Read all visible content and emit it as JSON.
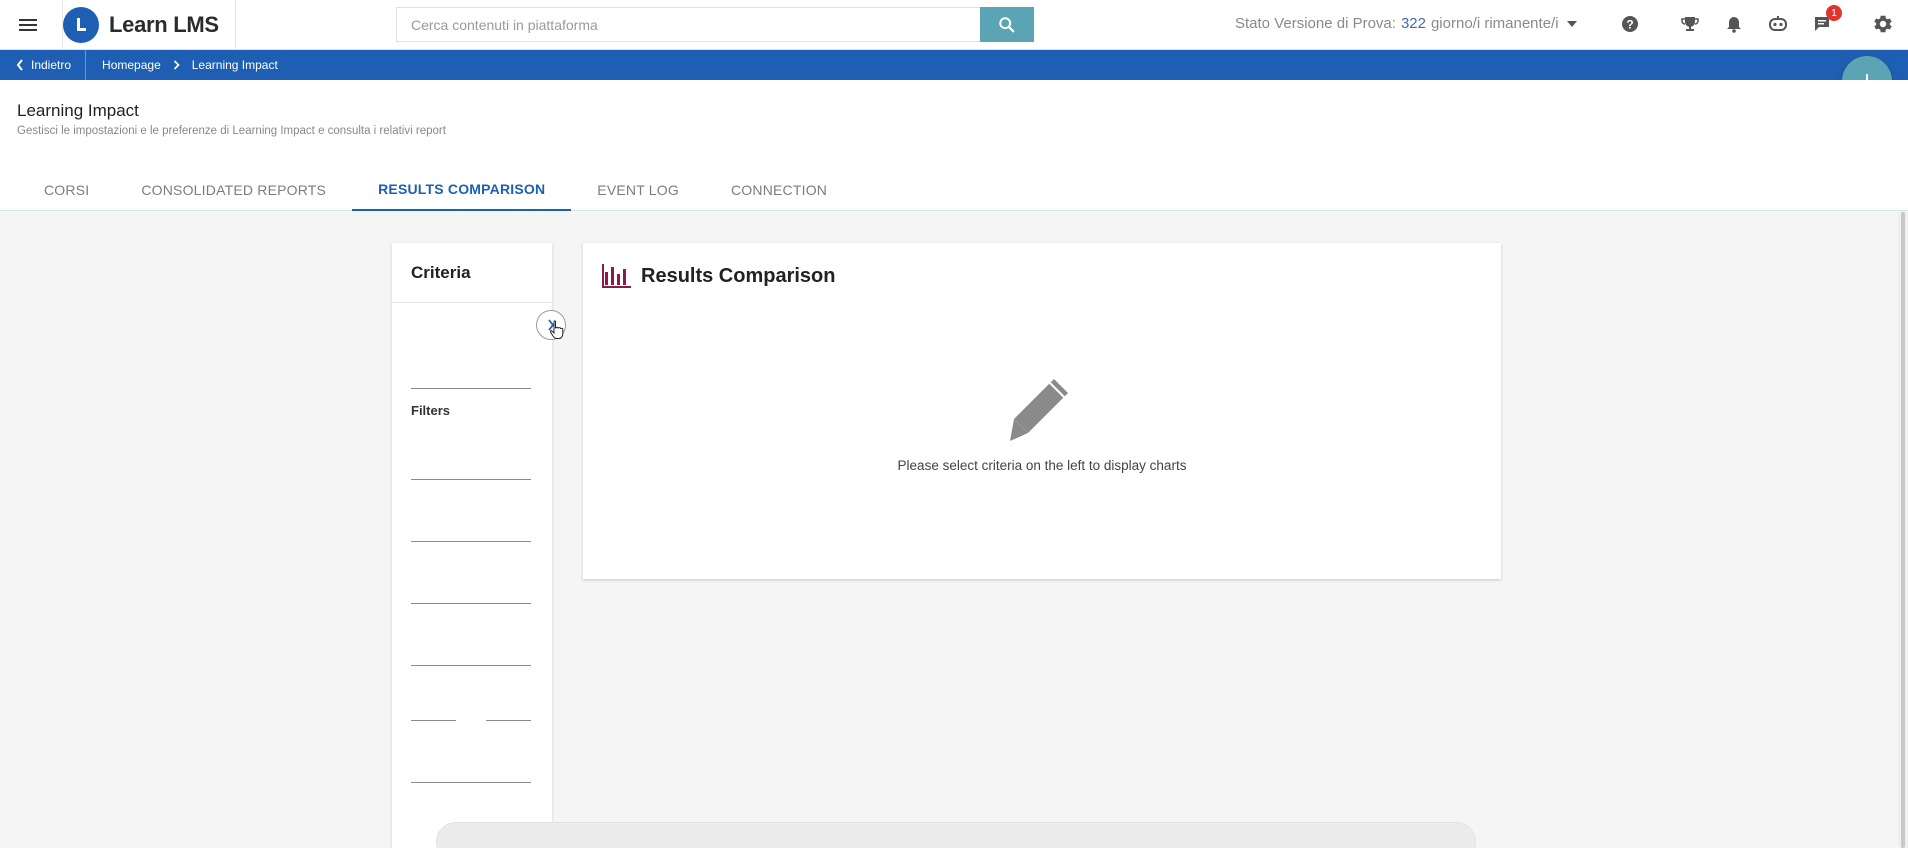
{
  "app": {
    "name": "Learn LMS"
  },
  "search": {
    "placeholder": "Cerca contenuti in piattaforma"
  },
  "trial": {
    "prefix": "Stato Versione di Prova:",
    "days": "322",
    "suffix": "giorno/i rimanente/i"
  },
  "notifications": {
    "chat_badge": "1"
  },
  "breadcrumb": {
    "back": "Indietro",
    "home": "Homepage",
    "current": "Learning Impact"
  },
  "page": {
    "title": "Learning Impact",
    "subtitle": "Gestisci le impostazioni e le preferenze di Learning Impact e consulta i relativi report"
  },
  "tabs": [
    {
      "label": "CORSI",
      "active": false
    },
    {
      "label": "CONSOLIDATED REPORTS",
      "active": false
    },
    {
      "label": "RESULTS COMPARISON",
      "active": true
    },
    {
      "label": "EVENT LOG",
      "active": false
    },
    {
      "label": "CONNECTION",
      "active": false
    }
  ],
  "criteria": {
    "title": "Criteria",
    "filters_label": "Filters"
  },
  "results": {
    "title": "Results Comparison",
    "empty_message": "Please select criteria on the left to display charts"
  },
  "colors": {
    "primary": "#1e5fb3",
    "accent": "#5aa4b4",
    "chart_icon": "#8b1a4a",
    "badge": "#e0342c"
  },
  "icons": {
    "menu": "hamburger-icon",
    "search": "search-icon",
    "help": "help-icon",
    "trophy": "trophy-icon",
    "bell": "bell-icon",
    "bot": "bot-icon",
    "chat": "chat-icon",
    "settings": "gear-icon",
    "add": "plus-icon",
    "empty": "pencil-icon",
    "chart": "bar-chart-icon"
  }
}
